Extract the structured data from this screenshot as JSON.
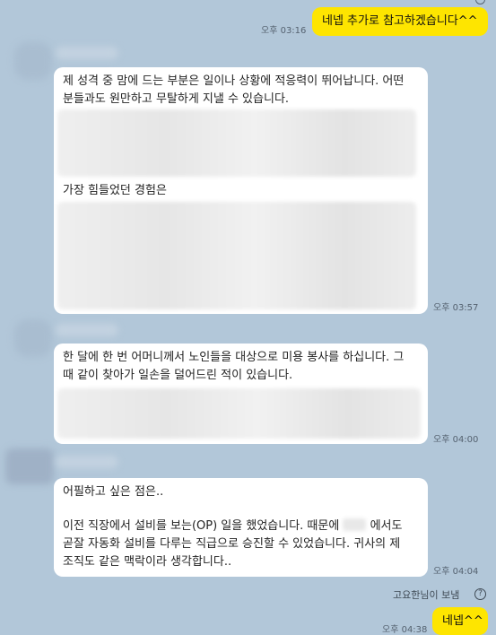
{
  "messages": {
    "m1": {
      "text": "네넵 추가로 참고하겠습니다^^",
      "time": "오후 03:16"
    },
    "m2": {
      "line1": "제 성격 중 맘에 드는 부분은 일이나 상황에 적응력이 뛰어납니다. 어떤",
      "line2": "분들과도 원만하고 무탈하게 지낼 수 있습니다.",
      "line3": "가장 힘들었던 경험은",
      "time": "오후 03:57"
    },
    "m3": {
      "line1": "한 달에 한 번 어머니께서 노인들을 대상으로 미용 봉사를 하십니다. 그",
      "line2": "때 같이 찾아가 일손을 덜어드린 적이 있습니다.",
      "time": "오후 04:00"
    },
    "m4": {
      "line1": "어필하고 싶은 점은..",
      "line2a": "이전 직장에서 설비를 보는(OP) 일을 했었습니다. 때문에",
      "line2b": "에서도",
      "line3": "곧잘 자동화 설비를 다루는 직급으로 승진할 수 있었습니다. 귀사의 제",
      "line4": "조직도 같은 맥락이라 생각합니다..",
      "time": "오후 04:04"
    },
    "notice": {
      "text": "고요한님이 보냄",
      "icon": "?"
    },
    "m5": {
      "text": "네넵^^",
      "time": "오후 04:38"
    }
  },
  "colors": {
    "background": "#b2c7d9",
    "my_bubble": "#fee500",
    "their_bubble": "#ffffff"
  }
}
